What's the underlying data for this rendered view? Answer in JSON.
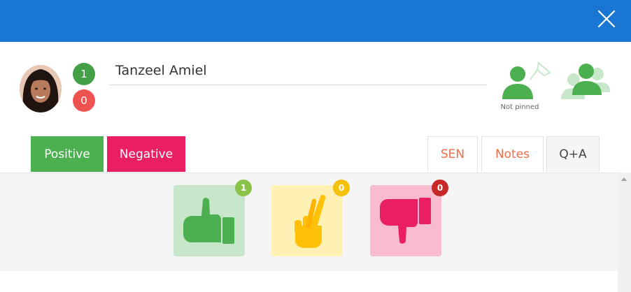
{
  "colors": {
    "brand": "#1976d2",
    "positive": "#4caf50",
    "negative": "#e91e63"
  },
  "header": {
    "close_icon": "close-icon"
  },
  "student": {
    "name": "Tanzeel Amiel",
    "positive_count": "1",
    "negative_count": "0"
  },
  "pin": {
    "label": "Not pinned",
    "icon": "pin-user-icon"
  },
  "group": {
    "icon": "group-icon"
  },
  "tabs": {
    "positive": "Positive",
    "negative": "Negative",
    "sen": "SEN",
    "notes": "Notes",
    "qa": "Q+A"
  },
  "reactions": [
    {
      "icon": "thumbs-up-icon",
      "count": "1"
    },
    {
      "icon": "crossed-fingers-icon",
      "count": "0"
    },
    {
      "icon": "thumbs-down-icon",
      "count": "0"
    }
  ]
}
